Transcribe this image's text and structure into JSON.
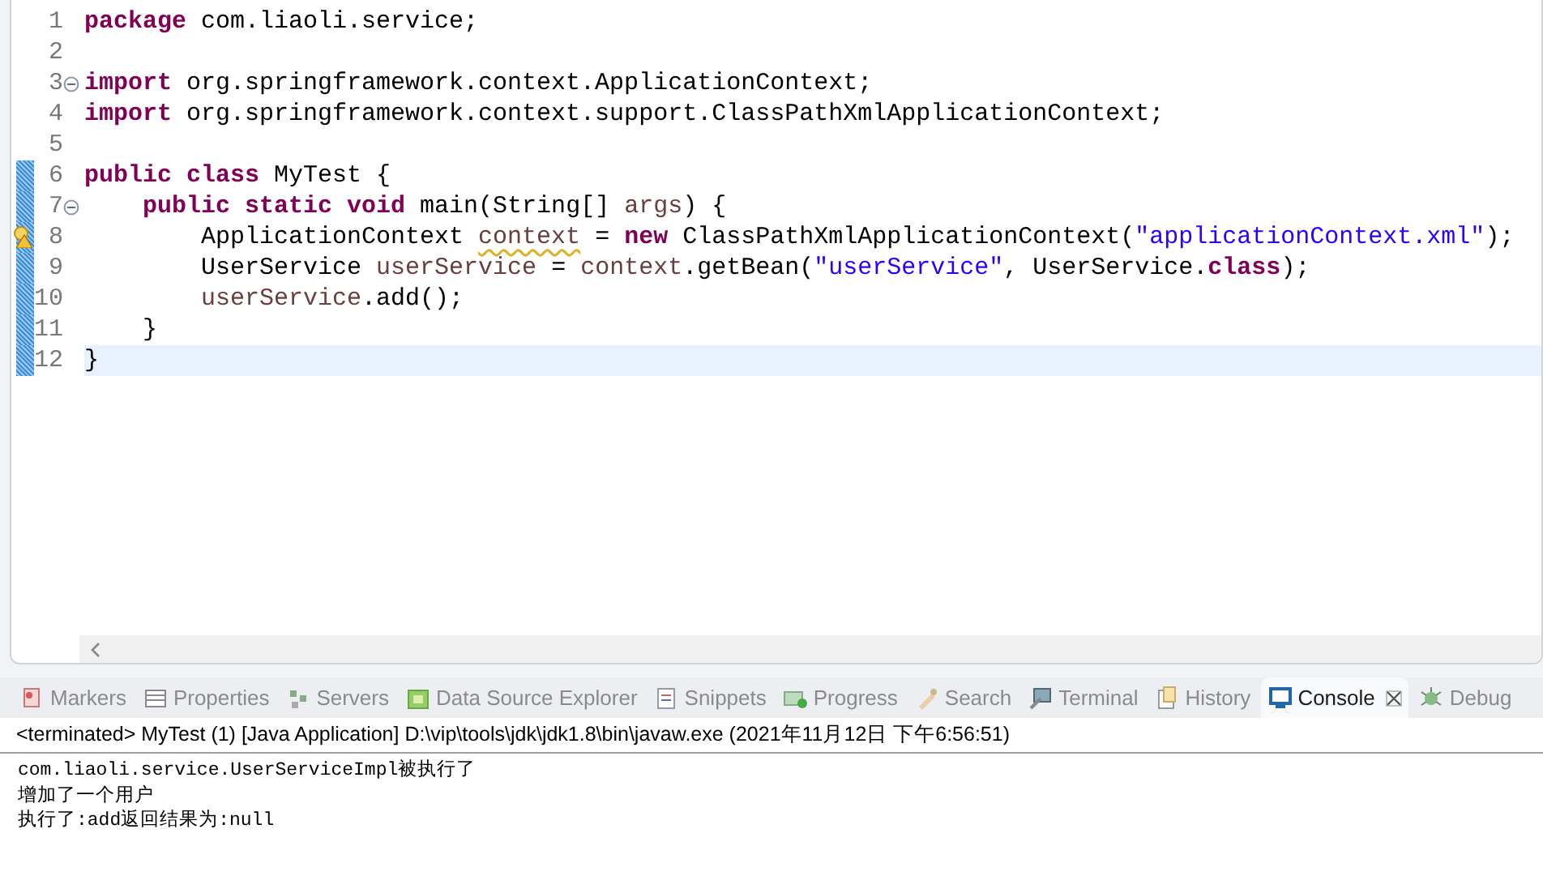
{
  "editor": {
    "lines": [
      {
        "number": "1",
        "fold": false,
        "changed": false,
        "warning": false,
        "current": false,
        "tokens": [
          {
            "kind": "keyword",
            "text": "package"
          },
          {
            "kind": "plain",
            "text": " com.liaoli.service;"
          }
        ]
      },
      {
        "number": "2",
        "fold": false,
        "changed": false,
        "warning": false,
        "current": false
      },
      {
        "number": "3",
        "fold": true,
        "changed": false,
        "warning": false,
        "current": false,
        "tokens": [
          {
            "kind": "keyword",
            "text": "import"
          },
          {
            "kind": "plain",
            "text": " org.springframework.context.ApplicationContext;"
          }
        ]
      },
      {
        "number": "4",
        "fold": false,
        "changed": false,
        "warning": false,
        "current": false,
        "tokens": [
          {
            "kind": "keyword",
            "text": "import"
          },
          {
            "kind": "plain",
            "text": " org.springframework.context.support.ClassPathXmlApplicationContext;"
          }
        ]
      },
      {
        "number": "5",
        "fold": false,
        "changed": false,
        "warning": false,
        "current": false
      },
      {
        "number": "6",
        "fold": false,
        "changed": true,
        "warning": false,
        "current": false,
        "tokens": [
          {
            "kind": "keyword",
            "text": "public class"
          },
          {
            "kind": "plain",
            "text": " MyTest {"
          }
        ]
      },
      {
        "number": "7",
        "fold": true,
        "changed": true,
        "warning": false,
        "current": false,
        "tokens": [
          {
            "kind": "keyword",
            "text": "    public static void"
          },
          {
            "kind": "plain",
            "text": " main(String[] "
          },
          {
            "kind": "variable",
            "text": "args"
          },
          {
            "kind": "plain",
            "text": ") {"
          }
        ]
      },
      {
        "number": "8",
        "fold": false,
        "changed": true,
        "warning": true,
        "current": false,
        "tokens": [
          {
            "kind": "plain",
            "text": "        ApplicationContext "
          },
          {
            "kind": "warned",
            "text": "context"
          },
          {
            "kind": "plain",
            "text": " = "
          },
          {
            "kind": "keyword",
            "text": "new"
          },
          {
            "kind": "plain",
            "text": " ClassPathXmlApplicationContext("
          },
          {
            "kind": "string",
            "text": "\"applicationContext.xml\""
          },
          {
            "kind": "plain",
            "text": ");"
          }
        ]
      },
      {
        "number": "9",
        "fold": false,
        "changed": true,
        "warning": false,
        "current": false,
        "tokens": [
          {
            "kind": "plain",
            "text": "        UserService "
          },
          {
            "kind": "variable",
            "text": "userService"
          },
          {
            "kind": "plain",
            "text": " = "
          },
          {
            "kind": "variable",
            "text": "context"
          },
          {
            "kind": "plain",
            "text": ".getBean("
          },
          {
            "kind": "string",
            "text": "\"userService\""
          },
          {
            "kind": "plain",
            "text": ", UserService."
          },
          {
            "kind": "keyword",
            "text": "class"
          },
          {
            "kind": "plain",
            "text": ");"
          }
        ]
      },
      {
        "number": "10",
        "fold": false,
        "changed": true,
        "warning": false,
        "current": false,
        "tokens": [
          {
            "kind": "variable",
            "text": "        userService"
          },
          {
            "kind": "plain",
            "text": ".add();"
          }
        ]
      },
      {
        "number": "11",
        "fold": false,
        "changed": true,
        "warning": false,
        "current": false,
        "tokens": [
          {
            "kind": "plain",
            "text": "    }"
          }
        ]
      },
      {
        "number": "12",
        "fold": false,
        "changed": true,
        "warning": false,
        "current": true,
        "tokens": [
          {
            "kind": "plain",
            "text": "}"
          }
        ]
      }
    ]
  },
  "views": {
    "tabs": [
      {
        "label": "Markers",
        "selected": false,
        "closable": false
      },
      {
        "label": "Properties",
        "selected": false,
        "closable": false
      },
      {
        "label": "Servers",
        "selected": false,
        "closable": false
      },
      {
        "label": "Data Source Explorer",
        "selected": false,
        "closable": false
      },
      {
        "label": "Snippets",
        "selected": false,
        "closable": false
      },
      {
        "label": "Progress",
        "selected": false,
        "closable": false
      },
      {
        "label": "Search",
        "selected": false,
        "closable": false
      },
      {
        "label": "Terminal",
        "selected": false,
        "closable": false
      },
      {
        "label": "History",
        "selected": false,
        "closable": false
      },
      {
        "label": "Console",
        "selected": true,
        "closable": true
      },
      {
        "label": "Debug",
        "selected": false,
        "closable": false
      }
    ]
  },
  "console": {
    "status": "<terminated> MyTest (1) [Java Application] D:\\vip\\tools\\jdk\\jdk1.8\\bin\\javaw.exe (2021年11月12日 下午6:56:51)",
    "output": [
      "com.liaoli.service.UserServiceImpl被执行了",
      "增加了一个用户",
      "执行了:add返回结果为:null"
    ]
  }
}
